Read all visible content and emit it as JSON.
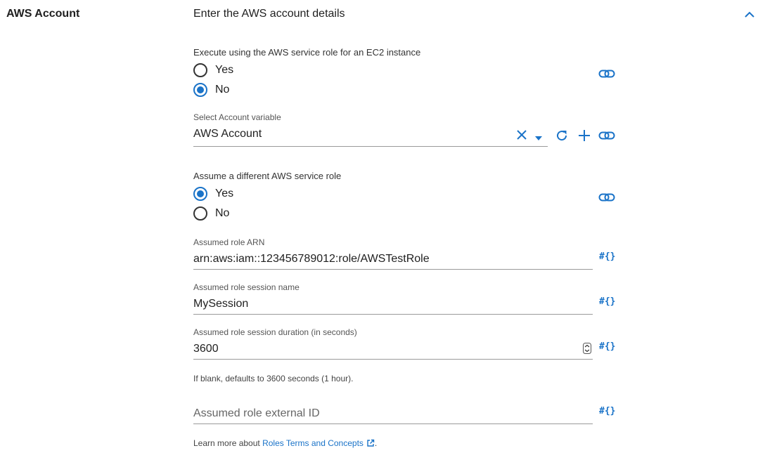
{
  "section": {
    "title": "AWS Account",
    "heading": "Enter the AWS account details"
  },
  "ec2_role": {
    "label": "Execute using the AWS service role for an EC2 instance",
    "options": [
      {
        "label": "Yes",
        "checked": false
      },
      {
        "label": "No",
        "checked": true
      }
    ]
  },
  "account_variable": {
    "label": "Select Account variable",
    "value": "AWS Account"
  },
  "assume_role": {
    "label": "Assume a different AWS service role",
    "options": [
      {
        "label": "Yes",
        "checked": true
      },
      {
        "label": "No",
        "checked": false
      }
    ]
  },
  "role_arn": {
    "label": "Assumed role ARN",
    "value": "arn:aws:iam::123456789012:role/AWSTestRole"
  },
  "session_name": {
    "label": "Assumed role session name",
    "value": "MySession"
  },
  "session_duration": {
    "label": "Assumed role session duration (in seconds)",
    "value": "3600",
    "hint": "If blank, defaults to 3600 seconds (1 hour)."
  },
  "external_id": {
    "placeholder": "Assumed role external ID"
  },
  "footer": {
    "prefix": "Learn more about ",
    "link_text": "Roles Terms and Concepts",
    "suffix": "."
  },
  "bind_symbol": "#{}",
  "colors": {
    "accent": "#1a73c8",
    "text": "#1f1f1f",
    "underline": "#9a9a9a"
  },
  "icons": {
    "collapse": "chevron-up-icon",
    "link": "link-icon",
    "clear": "close-icon",
    "dropdown": "caret-down-icon",
    "refresh": "refresh-icon",
    "add": "plus-icon",
    "spinner": "stepper-icon",
    "external": "external-link-icon"
  }
}
